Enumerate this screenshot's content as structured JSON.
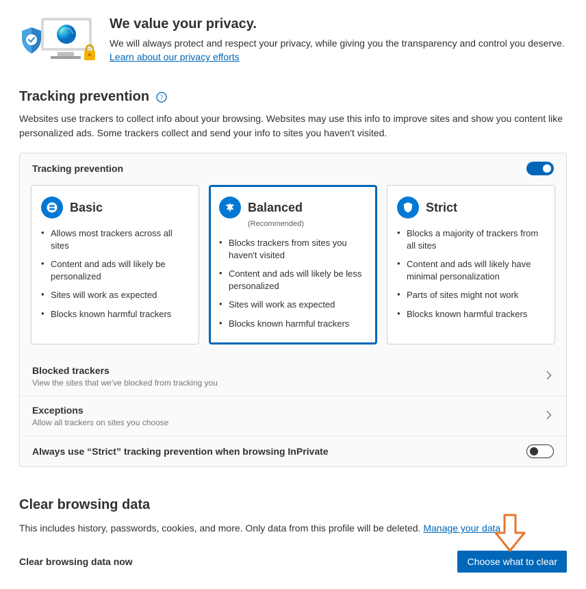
{
  "header": {
    "title": "We value your privacy.",
    "body": "We will always protect and respect your privacy, while giving you the transparency and control you deserve. ",
    "link": "Learn about our privacy efforts"
  },
  "tracking": {
    "title": "Tracking prevention",
    "help_aria": "Learn more about tracking prevention",
    "desc": "Websites use trackers to collect info about your browsing. Websites may use this info to improve sites and show you content like personalized ads. Some trackers collect and send your info to sites you haven't visited.",
    "toggle_label": "Tracking prevention",
    "toggle_on": true,
    "levels": [
      {
        "id": "basic",
        "name": "Basic",
        "sub": "",
        "selected": false,
        "bullets": [
          "Allows most trackers across all sites",
          "Content and ads will likely be personalized",
          "Sites will work as expected",
          "Blocks known harmful trackers"
        ]
      },
      {
        "id": "balanced",
        "name": "Balanced",
        "sub": "(Recommended)",
        "selected": true,
        "bullets": [
          "Blocks trackers from sites you haven't visited",
          "Content and ads will likely be less personalized",
          "Sites will work as expected",
          "Blocks known harmful trackers"
        ]
      },
      {
        "id": "strict",
        "name": "Strict",
        "sub": "",
        "selected": false,
        "bullets": [
          "Blocks a majority of trackers from all sites",
          "Content and ads will likely have minimal personalization",
          "Parts of sites might not work",
          "Blocks known harmful trackers"
        ]
      }
    ],
    "blocked": {
      "title": "Blocked trackers",
      "sub": "View the sites that we've blocked from tracking you"
    },
    "exceptions": {
      "title": "Exceptions",
      "sub": "Allow all trackers on sites you choose"
    },
    "strict_inprivate": {
      "title": "Always use “Strict” tracking prevention when browsing InPrivate",
      "on": false
    }
  },
  "clear": {
    "title": "Clear browsing data",
    "desc": "This includes history, passwords, cookies, and more. Only data from this profile will be deleted. ",
    "link": "Manage your data",
    "now_label": "Clear browsing data now",
    "button": "Choose what to clear"
  }
}
